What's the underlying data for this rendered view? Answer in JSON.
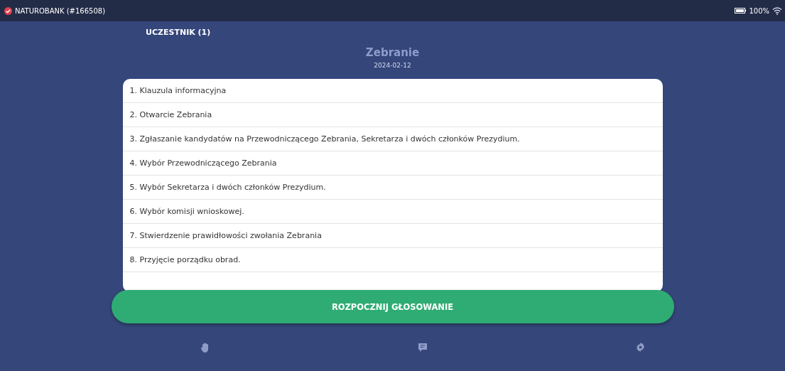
{
  "status_bar": {
    "account": "NATUROBANK (#166508)",
    "battery": "100%"
  },
  "role": "UCZESTNIK (1)",
  "meeting": {
    "title": "Zebranie",
    "date": "2024-02-12"
  },
  "agenda": [
    {
      "text": "1. Klauzula informacyjna"
    },
    {
      "text": "2. Otwarcie Zebrania"
    },
    {
      "text": "3. Zgłaszanie kandydatów na Przewodniczącego Zebrania, Sekretarza i dwóch członków Prezydium."
    },
    {
      "text": "4. Wybór Przewodniczącego Zebrania"
    },
    {
      "text": "5. Wybór Sekretarza i dwóch członków Prezydium."
    },
    {
      "text": "6. Wybór komisji wnioskowej."
    },
    {
      "text": "7. Stwierdzenie prawidłowości zwołania Zebrania"
    },
    {
      "text": "8. Przyjęcie porządku obrad."
    }
  ],
  "start_button": "ROZPOCZNIJ GŁOSOWANIE",
  "nav": [
    {
      "kind": "hand"
    },
    {
      "kind": "chat"
    },
    {
      "kind": "settings"
    }
  ]
}
